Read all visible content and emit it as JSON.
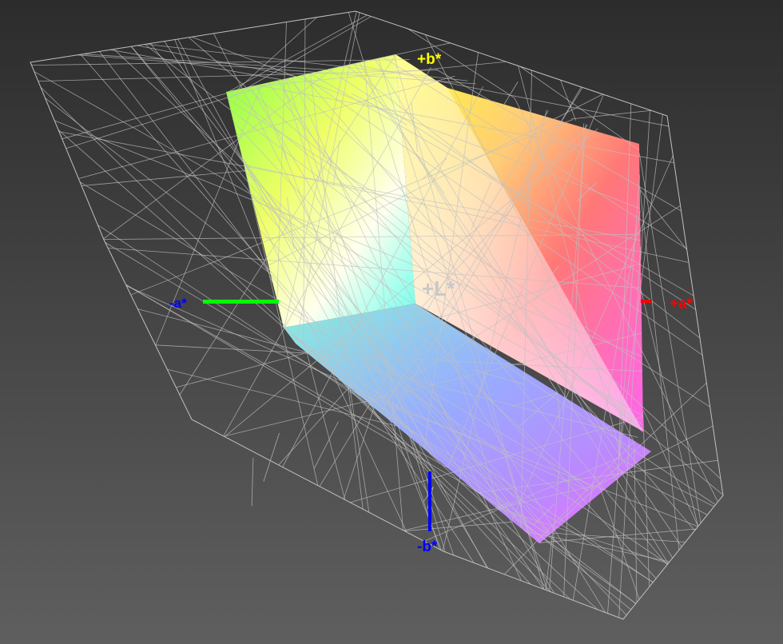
{
  "axes": {
    "b_plus": "+b*",
    "b_minus": "-b*",
    "a_plus": "+a*",
    "a_minus": "-a*",
    "l_plus": "+L*"
  },
  "colors": {
    "b_plus": "#ffff00",
    "b_minus": "#0000ff",
    "a_plus": "#ff0000",
    "a_minus": "#0000ff",
    "a_minus_line": "#00ff00",
    "l_plus": "#c8c8c8",
    "wire": "#c0c0c0"
  }
}
